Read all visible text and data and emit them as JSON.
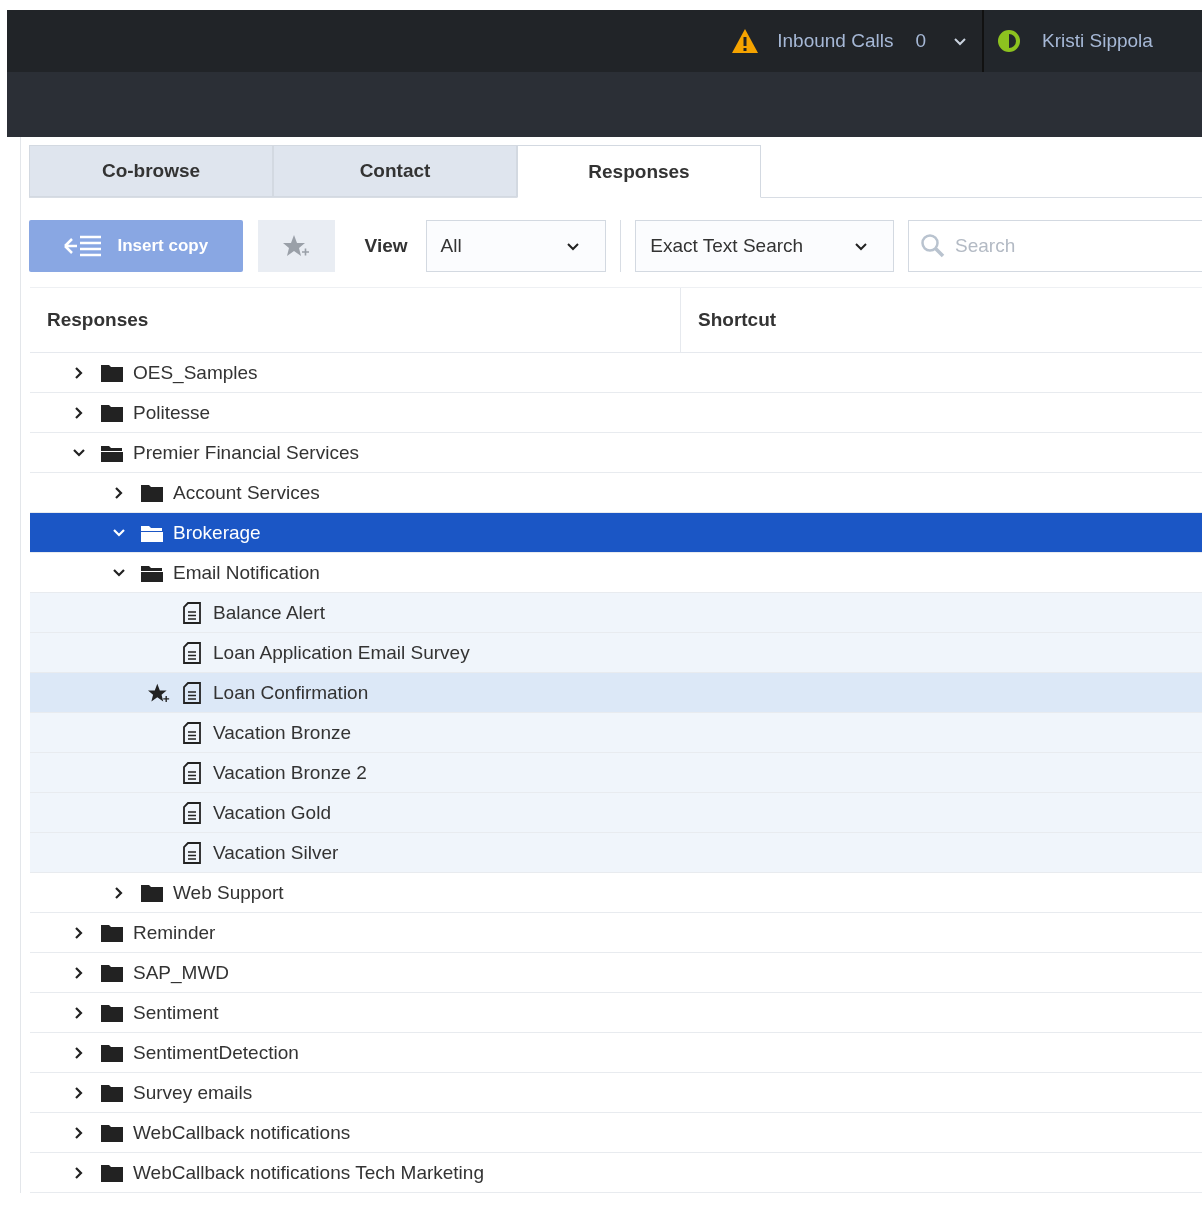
{
  "header": {
    "alert_label": "Inbound Calls",
    "alert_count": "0",
    "user_name": "Kristi Sippola"
  },
  "tabs": [
    {
      "label": "Co-browse",
      "selected": false
    },
    {
      "label": "Contact",
      "selected": false
    },
    {
      "label": "Responses",
      "selected": true
    }
  ],
  "toolbar": {
    "insert_button": "Insert copy",
    "view_label": "View",
    "view_value": "All",
    "search_mode": "Exact Text Search",
    "search": {
      "placeholder": "Search"
    }
  },
  "table": {
    "columns": [
      "Responses",
      "Shortcut"
    ],
    "rows": [
      {
        "kind": "folder",
        "label": "OES_Samples",
        "expanded": false,
        "selected": false
      },
      {
        "kind": "folder",
        "label": "Politesse",
        "expanded": false,
        "selected": false
      },
      {
        "kind": "folder",
        "label": "Premier Financial Services",
        "expanded": true,
        "selected": false,
        "children": [
          {
            "kind": "folder",
            "label": "Account Services",
            "expanded": false,
            "selected": false
          },
          {
            "kind": "folder",
            "label": "Brokerage",
            "expanded": true,
            "selected": true
          },
          {
            "kind": "folder",
            "label": "Email Notification",
            "expanded": true,
            "selected": false,
            "children": [
              {
                "kind": "response",
                "label": "Balance Alert",
                "hovered": false,
                "selected": false
              },
              {
                "kind": "response",
                "label": "Loan Application Email Survey",
                "hovered": false,
                "selected": false
              },
              {
                "kind": "response",
                "label": "Loan Confirmation",
                "hovered": true,
                "selected": false
              },
              {
                "kind": "response",
                "label": "Vacation Bronze",
                "hovered": false,
                "selected": false
              },
              {
                "kind": "response",
                "label": "Vacation Bronze 2",
                "hovered": false,
                "selected": false
              },
              {
                "kind": "response",
                "label": "Vacation Gold",
                "hovered": false,
                "selected": false
              },
              {
                "kind": "response",
                "label": "Vacation Silver",
                "hovered": false,
                "selected": false
              }
            ]
          },
          {
            "kind": "folder",
            "label": "Web Support",
            "expanded": false,
            "selected": false
          }
        ]
      },
      {
        "kind": "folder",
        "label": "Reminder",
        "expanded": false,
        "selected": false
      },
      {
        "kind": "folder",
        "label": "SAP_MWD",
        "expanded": false,
        "selected": false
      },
      {
        "kind": "folder",
        "label": "Sentiment",
        "expanded": false,
        "selected": false
      },
      {
        "kind": "folder",
        "label": "SentimentDetection",
        "expanded": false,
        "selected": false
      },
      {
        "kind": "folder",
        "label": "Survey emails",
        "expanded": false,
        "selected": false
      },
      {
        "kind": "folder",
        "label": "WebCallback notifications",
        "expanded": false,
        "selected": false
      },
      {
        "kind": "folder",
        "label": "WebCallback notifications Tech Marketing",
        "expanded": false,
        "selected": false
      }
    ]
  }
}
